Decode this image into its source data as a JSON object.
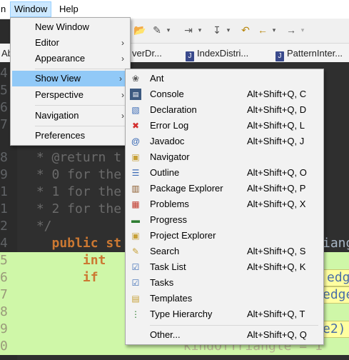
{
  "menubar": {
    "items": [
      {
        "label": "n"
      },
      {
        "label": "Window"
      },
      {
        "label": "Help"
      }
    ]
  },
  "tabs": [
    {
      "label": "Ab"
    },
    {
      "label": "verDr..."
    },
    {
      "label": "IndexDistri..."
    },
    {
      "label": "PatternInter..."
    }
  ],
  "editor": {
    "lines": [
      {
        "num": "4",
        "code": ""
      },
      {
        "num": "5",
        "code": ""
      },
      {
        "num": "6",
        "code": ""
      },
      {
        "num": "7",
        "code": ""
      },
      {
        "num": "8",
        "code": " * @return t"
      },
      {
        "num": "9",
        "code": " * 0 for the"
      },
      {
        "num": "1",
        "code": " * 1 for the"
      },
      {
        "num": "1",
        "code": " * 2 for the"
      },
      {
        "num": "2",
        "code": " */"
      },
      {
        "num": "4",
        "code": "   public st"
      },
      {
        "num": "5",
        "code": "       int"
      },
      {
        "num": "6",
        "code": "       if"
      },
      {
        "num": "7",
        "code": ""
      },
      {
        "num": "8",
        "code": ""
      },
      {
        "num": "9",
        "code": ""
      },
      {
        "num": "0",
        "code": "                    kindOfTriangle = 1"
      }
    ],
    "right_snippets": {
      "s1": "iang",
      "s2": "edg",
      "s3": "edge",
      "s4": "e2)"
    }
  },
  "window_menu": {
    "items": [
      {
        "label": "New Window",
        "submenu": false
      },
      {
        "label": "Editor",
        "submenu": true
      },
      {
        "label": "Appearance",
        "submenu": true
      },
      {
        "label": "Show View",
        "submenu": true,
        "selected": true
      },
      {
        "label": "Perspective",
        "submenu": true
      },
      {
        "label": "Navigation",
        "submenu": true
      },
      {
        "label": "Preferences",
        "submenu": false
      }
    ]
  },
  "show_view_menu": {
    "items": [
      {
        "label": "Ant",
        "shortcut": "",
        "icon": "ant-icon"
      },
      {
        "label": "Console",
        "shortcut": "Alt+Shift+Q, C",
        "icon": "console-icon"
      },
      {
        "label": "Declaration",
        "shortcut": "Alt+Shift+Q, D",
        "icon": "declaration-icon"
      },
      {
        "label": "Error Log",
        "shortcut": "Alt+Shift+Q, L",
        "icon": "error-log-icon"
      },
      {
        "label": "Javadoc",
        "shortcut": "Alt+Shift+Q, J",
        "icon": "javadoc-icon"
      },
      {
        "label": "Navigator",
        "shortcut": "",
        "icon": "navigator-icon"
      },
      {
        "label": "Outline",
        "shortcut": "Alt+Shift+Q, O",
        "icon": "outline-icon"
      },
      {
        "label": "Package Explorer",
        "shortcut": "Alt+Shift+Q, P",
        "icon": "package-explorer-icon"
      },
      {
        "label": "Problems",
        "shortcut": "Alt+Shift+Q, X",
        "icon": "problems-icon"
      },
      {
        "label": "Progress",
        "shortcut": "",
        "icon": "progress-icon"
      },
      {
        "label": "Project Explorer",
        "shortcut": "",
        "icon": "project-explorer-icon"
      },
      {
        "label": "Search",
        "shortcut": "Alt+Shift+Q, S",
        "icon": "search-icon"
      },
      {
        "label": "Task List",
        "shortcut": "Alt+Shift+Q, K",
        "icon": "task-list-icon"
      },
      {
        "label": "Tasks",
        "shortcut": "",
        "icon": "tasks-icon"
      },
      {
        "label": "Templates",
        "shortcut": "",
        "icon": "templates-icon"
      },
      {
        "label": "Type Hierarchy",
        "shortcut": "Alt+Shift+Q, T",
        "icon": "type-hierarchy-icon"
      },
      {
        "label": "Other...",
        "shortcut": "Alt+Shift+Q, Q",
        "icon": ""
      }
    ]
  }
}
